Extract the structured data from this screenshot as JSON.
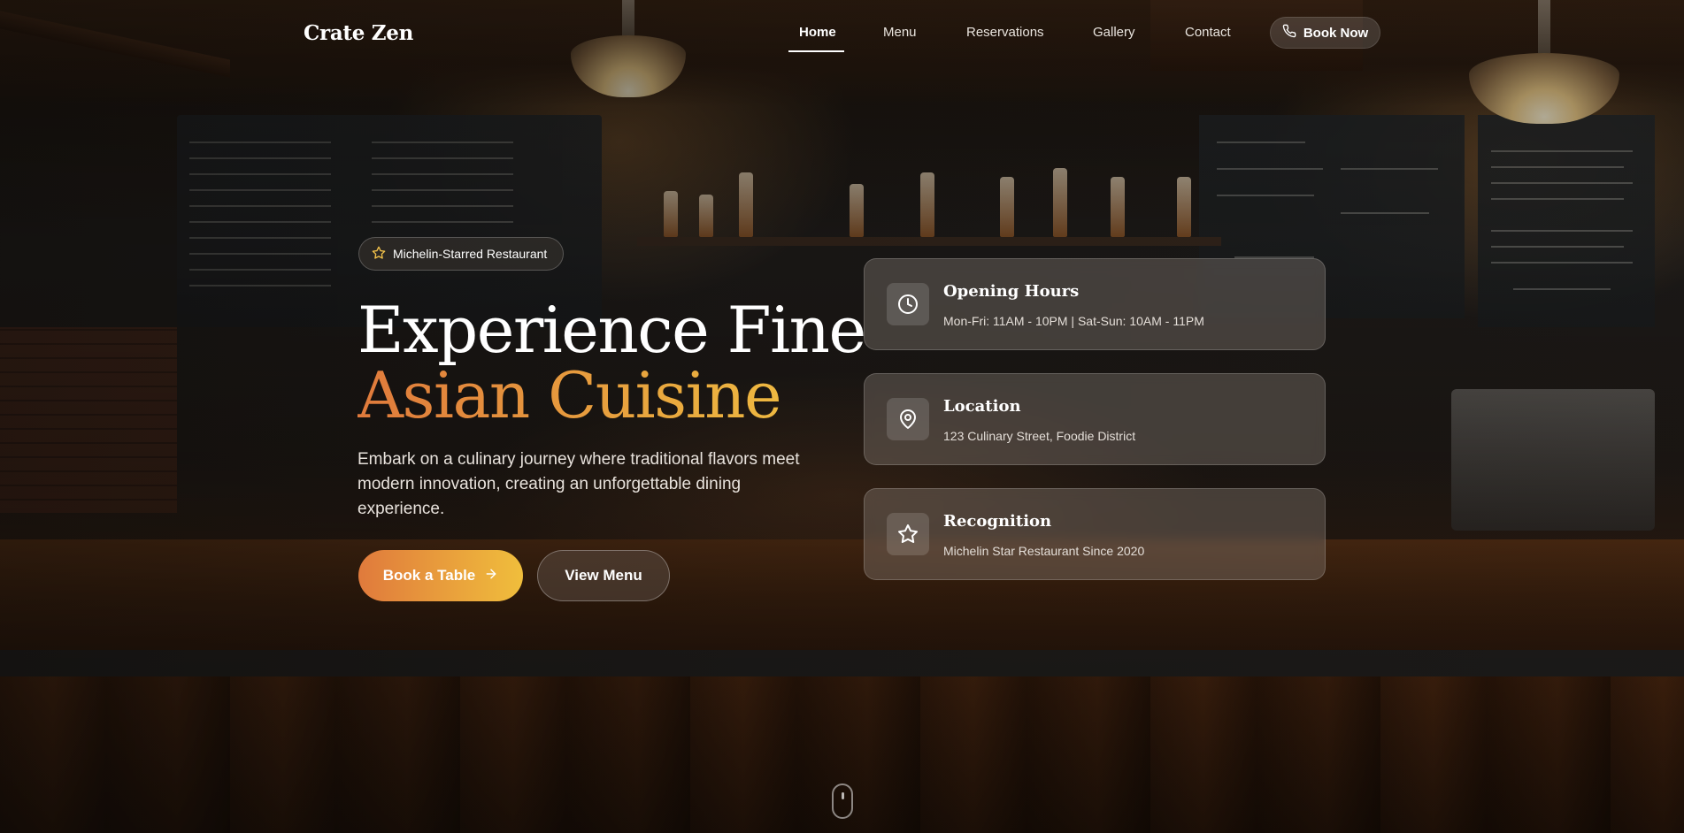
{
  "brand": {
    "name": "Crate Zen"
  },
  "nav": {
    "items": [
      {
        "label": "Home",
        "active": true
      },
      {
        "label": "Menu",
        "active": false
      },
      {
        "label": "Reservations",
        "active": false
      },
      {
        "label": "Gallery",
        "active": false
      },
      {
        "label": "Contact",
        "active": false
      }
    ],
    "cta": {
      "label": "Book Now",
      "icon": "phone-icon"
    }
  },
  "hero": {
    "badge": {
      "label": "Michelin-Starred Restaurant",
      "icon": "star-icon"
    },
    "headline_line1": "Experience Fine",
    "headline_line2": "Asian Cuisine",
    "subtitle": "Embark on a culinary journey where traditional flavors meet modern innovation, creating an unforgettable dining experience.",
    "primary_button": {
      "label": "Book a Table",
      "icon": "arrow-right-icon"
    },
    "secondary_button": {
      "label": "View Menu"
    }
  },
  "info_cards": [
    {
      "title": "Opening Hours",
      "text": "Mon-Fri: 11AM - 10PM | Sat-Sun: 10AM - 11PM",
      "icon": "clock-icon"
    },
    {
      "title": "Location",
      "text": "123 Culinary Street, Foodie District",
      "icon": "map-pin-icon"
    },
    {
      "title": "Recognition",
      "text": "Michelin Star Restaurant Since 2020",
      "icon": "star-icon"
    }
  ],
  "colors": {
    "accent_start": "#e07a3c",
    "accent_end": "#f0be3c",
    "text_primary": "#ffffff"
  }
}
